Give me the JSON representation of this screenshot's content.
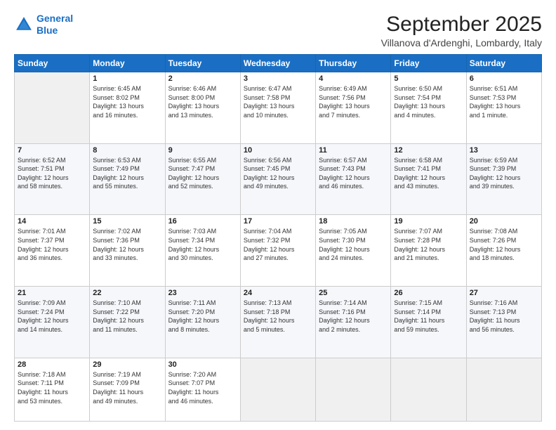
{
  "header": {
    "logo_line1": "General",
    "logo_line2": "Blue",
    "main_title": "September 2025",
    "subtitle": "Villanova d'Ardenghi, Lombardy, Italy"
  },
  "days_of_week": [
    "Sunday",
    "Monday",
    "Tuesday",
    "Wednesday",
    "Thursday",
    "Friday",
    "Saturday"
  ],
  "weeks": [
    [
      {
        "day": "",
        "lines": []
      },
      {
        "day": "1",
        "lines": [
          "Sunrise: 6:45 AM",
          "Sunset: 8:02 PM",
          "Daylight: 13 hours",
          "and 16 minutes."
        ]
      },
      {
        "day": "2",
        "lines": [
          "Sunrise: 6:46 AM",
          "Sunset: 8:00 PM",
          "Daylight: 13 hours",
          "and 13 minutes."
        ]
      },
      {
        "day": "3",
        "lines": [
          "Sunrise: 6:47 AM",
          "Sunset: 7:58 PM",
          "Daylight: 13 hours",
          "and 10 minutes."
        ]
      },
      {
        "day": "4",
        "lines": [
          "Sunrise: 6:49 AM",
          "Sunset: 7:56 PM",
          "Daylight: 13 hours",
          "and 7 minutes."
        ]
      },
      {
        "day": "5",
        "lines": [
          "Sunrise: 6:50 AM",
          "Sunset: 7:54 PM",
          "Daylight: 13 hours",
          "and 4 minutes."
        ]
      },
      {
        "day": "6",
        "lines": [
          "Sunrise: 6:51 AM",
          "Sunset: 7:53 PM",
          "Daylight: 13 hours",
          "and 1 minute."
        ]
      }
    ],
    [
      {
        "day": "7",
        "lines": [
          "Sunrise: 6:52 AM",
          "Sunset: 7:51 PM",
          "Daylight: 12 hours",
          "and 58 minutes."
        ]
      },
      {
        "day": "8",
        "lines": [
          "Sunrise: 6:53 AM",
          "Sunset: 7:49 PM",
          "Daylight: 12 hours",
          "and 55 minutes."
        ]
      },
      {
        "day": "9",
        "lines": [
          "Sunrise: 6:55 AM",
          "Sunset: 7:47 PM",
          "Daylight: 12 hours",
          "and 52 minutes."
        ]
      },
      {
        "day": "10",
        "lines": [
          "Sunrise: 6:56 AM",
          "Sunset: 7:45 PM",
          "Daylight: 12 hours",
          "and 49 minutes."
        ]
      },
      {
        "day": "11",
        "lines": [
          "Sunrise: 6:57 AM",
          "Sunset: 7:43 PM",
          "Daylight: 12 hours",
          "and 46 minutes."
        ]
      },
      {
        "day": "12",
        "lines": [
          "Sunrise: 6:58 AM",
          "Sunset: 7:41 PM",
          "Daylight: 12 hours",
          "and 43 minutes."
        ]
      },
      {
        "day": "13",
        "lines": [
          "Sunrise: 6:59 AM",
          "Sunset: 7:39 PM",
          "Daylight: 12 hours",
          "and 39 minutes."
        ]
      }
    ],
    [
      {
        "day": "14",
        "lines": [
          "Sunrise: 7:01 AM",
          "Sunset: 7:37 PM",
          "Daylight: 12 hours",
          "and 36 minutes."
        ]
      },
      {
        "day": "15",
        "lines": [
          "Sunrise: 7:02 AM",
          "Sunset: 7:36 PM",
          "Daylight: 12 hours",
          "and 33 minutes."
        ]
      },
      {
        "day": "16",
        "lines": [
          "Sunrise: 7:03 AM",
          "Sunset: 7:34 PM",
          "Daylight: 12 hours",
          "and 30 minutes."
        ]
      },
      {
        "day": "17",
        "lines": [
          "Sunrise: 7:04 AM",
          "Sunset: 7:32 PM",
          "Daylight: 12 hours",
          "and 27 minutes."
        ]
      },
      {
        "day": "18",
        "lines": [
          "Sunrise: 7:05 AM",
          "Sunset: 7:30 PM",
          "Daylight: 12 hours",
          "and 24 minutes."
        ]
      },
      {
        "day": "19",
        "lines": [
          "Sunrise: 7:07 AM",
          "Sunset: 7:28 PM",
          "Daylight: 12 hours",
          "and 21 minutes."
        ]
      },
      {
        "day": "20",
        "lines": [
          "Sunrise: 7:08 AM",
          "Sunset: 7:26 PM",
          "Daylight: 12 hours",
          "and 18 minutes."
        ]
      }
    ],
    [
      {
        "day": "21",
        "lines": [
          "Sunrise: 7:09 AM",
          "Sunset: 7:24 PM",
          "Daylight: 12 hours",
          "and 14 minutes."
        ]
      },
      {
        "day": "22",
        "lines": [
          "Sunrise: 7:10 AM",
          "Sunset: 7:22 PM",
          "Daylight: 12 hours",
          "and 11 minutes."
        ]
      },
      {
        "day": "23",
        "lines": [
          "Sunrise: 7:11 AM",
          "Sunset: 7:20 PM",
          "Daylight: 12 hours",
          "and 8 minutes."
        ]
      },
      {
        "day": "24",
        "lines": [
          "Sunrise: 7:13 AM",
          "Sunset: 7:18 PM",
          "Daylight: 12 hours",
          "and 5 minutes."
        ]
      },
      {
        "day": "25",
        "lines": [
          "Sunrise: 7:14 AM",
          "Sunset: 7:16 PM",
          "Daylight: 12 hours",
          "and 2 minutes."
        ]
      },
      {
        "day": "26",
        "lines": [
          "Sunrise: 7:15 AM",
          "Sunset: 7:14 PM",
          "Daylight: 11 hours",
          "and 59 minutes."
        ]
      },
      {
        "day": "27",
        "lines": [
          "Sunrise: 7:16 AM",
          "Sunset: 7:13 PM",
          "Daylight: 11 hours",
          "and 56 minutes."
        ]
      }
    ],
    [
      {
        "day": "28",
        "lines": [
          "Sunrise: 7:18 AM",
          "Sunset: 7:11 PM",
          "Daylight: 11 hours",
          "and 53 minutes."
        ]
      },
      {
        "day": "29",
        "lines": [
          "Sunrise: 7:19 AM",
          "Sunset: 7:09 PM",
          "Daylight: 11 hours",
          "and 49 minutes."
        ]
      },
      {
        "day": "30",
        "lines": [
          "Sunrise: 7:20 AM",
          "Sunset: 7:07 PM",
          "Daylight: 11 hours",
          "and 46 minutes."
        ]
      },
      {
        "day": "",
        "lines": []
      },
      {
        "day": "",
        "lines": []
      },
      {
        "day": "",
        "lines": []
      },
      {
        "day": "",
        "lines": []
      }
    ]
  ]
}
